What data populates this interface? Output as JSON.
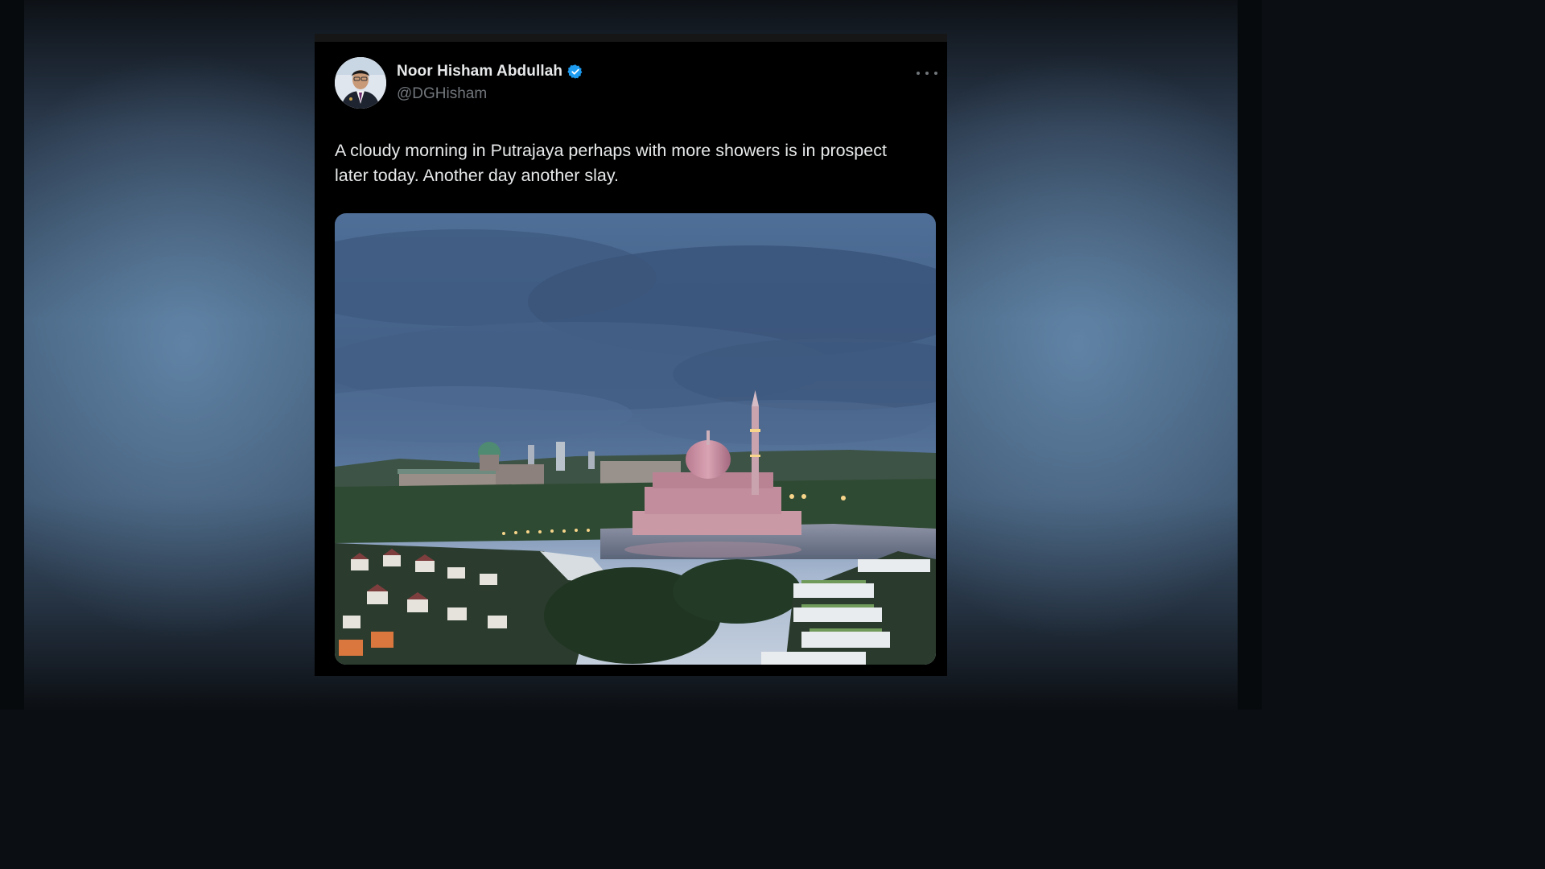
{
  "tweet": {
    "author_name": "Noor Hisham Abdullah",
    "handle": "@DGHisham",
    "verified": true,
    "text": "A cloudy morning in Putrajaya perhaps with more showers is in prospect later today. Another day another slay.",
    "more_icon": "more-horizontal-icon",
    "verified_icon": "verified-badge-icon"
  },
  "colors": {
    "card_bg": "#000000",
    "name": "#e7e9ea",
    "handle": "#71767b",
    "verified_blue": "#1d9bf0"
  }
}
